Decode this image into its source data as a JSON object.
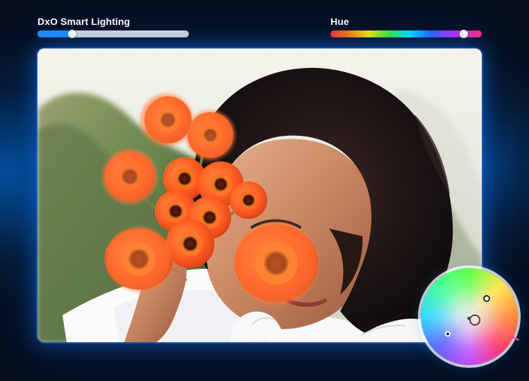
{
  "controls": {
    "smart_lighting": {
      "label": "DxO Smart Lighting",
      "value": 0.23
    },
    "hue": {
      "label": "Hue",
      "value": 0.88
    }
  },
  "icons": {
    "color_wheel": "color-wheel-icon"
  },
  "colors": {
    "accent_blue": "#1b8fff",
    "track_gray": "#d7d7d9"
  }
}
